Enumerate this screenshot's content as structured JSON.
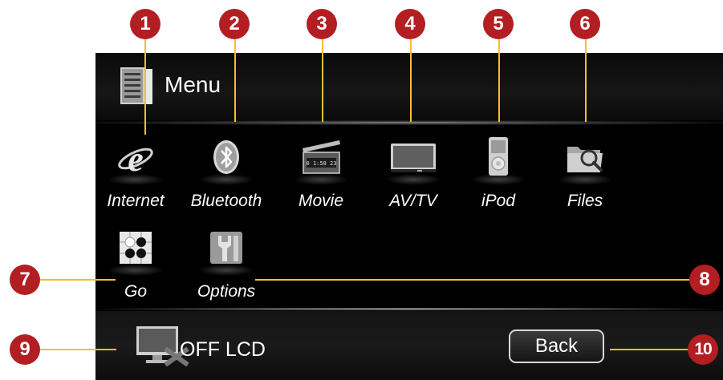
{
  "header": {
    "title": "Menu",
    "icon": "menu-list-icon"
  },
  "apps": [
    {
      "label": "Internet",
      "icon": "internet-explorer-icon"
    },
    {
      "label": "Bluetooth",
      "icon": "bluetooth-icon"
    },
    {
      "label": "Movie",
      "icon": "movie-clapper-icon",
      "clock_text": "0 1:58 23"
    },
    {
      "label": "AV/TV",
      "icon": "tv-icon"
    },
    {
      "label": "iPod",
      "icon": "ipod-icon"
    },
    {
      "label": "Files",
      "icon": "folder-search-icon"
    },
    {
      "label": "Go",
      "icon": "go-board-icon"
    },
    {
      "label": "Options",
      "icon": "options-tools-icon"
    }
  ],
  "footer": {
    "lcd_label": "OFF LCD",
    "lcd_icon": "monitor-off-icon",
    "back_label": "Back"
  },
  "callouts": [
    "1",
    "2",
    "3",
    "4",
    "5",
    "6",
    "7",
    "8",
    "9",
    "10"
  ],
  "colors": {
    "callout": "#b31e22",
    "leader": "#f6be2f",
    "screen_bg": "#000000"
  }
}
